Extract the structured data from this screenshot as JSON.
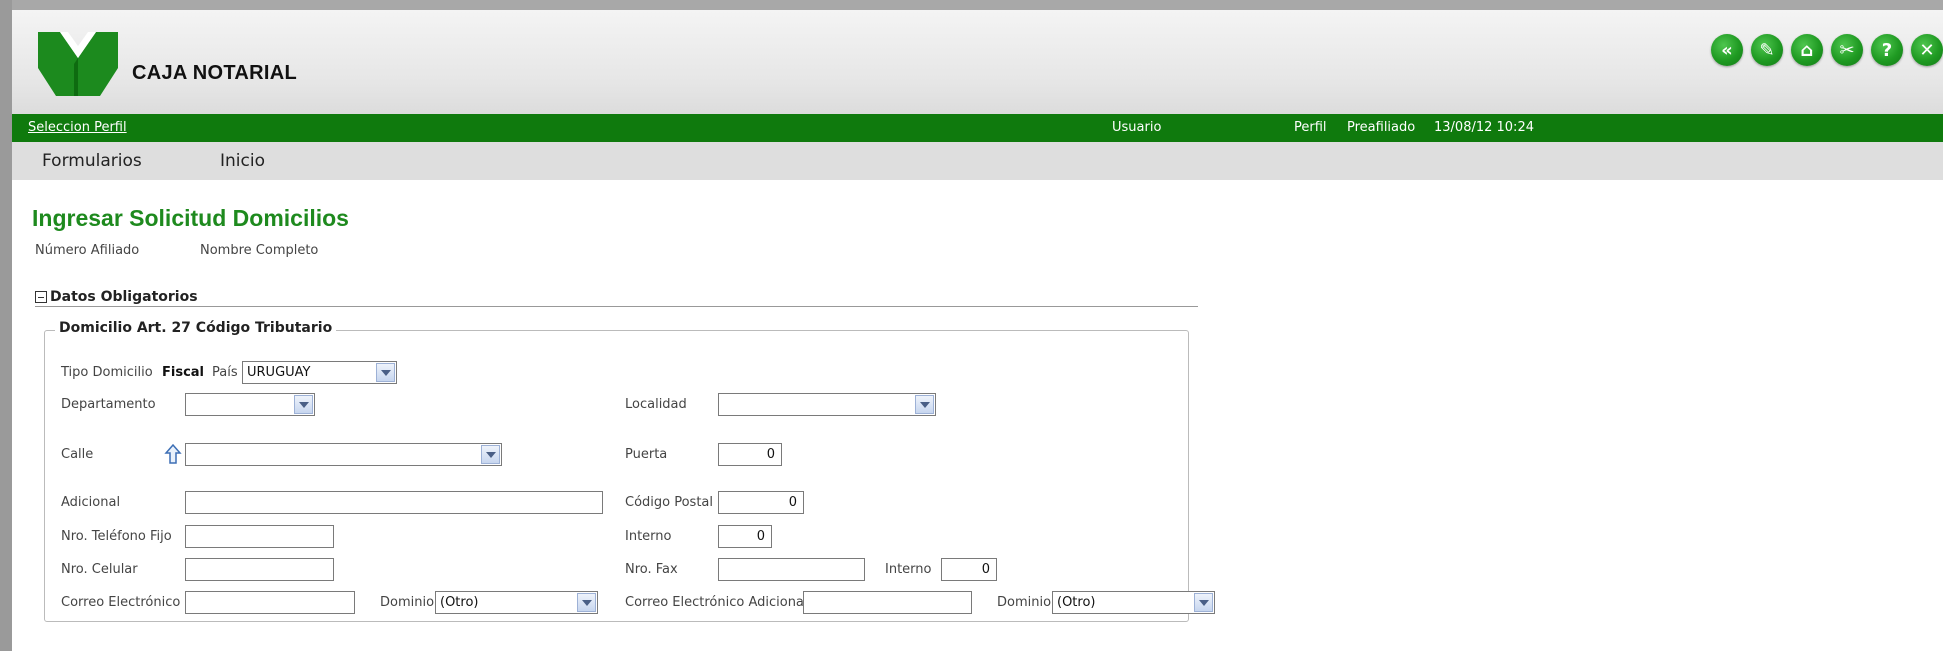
{
  "brand": {
    "name": "CAJA NOTARIAL"
  },
  "header_icons": [
    {
      "name": "back-double-icon",
      "glyph": "«"
    },
    {
      "name": "edit-icon",
      "glyph": "✎"
    },
    {
      "name": "home-icon",
      "glyph": "⌂"
    },
    {
      "name": "tools-icon",
      "glyph": "✂"
    },
    {
      "name": "help-icon",
      "glyph": "?"
    },
    {
      "name": "close-icon",
      "glyph": "✕"
    }
  ],
  "statusbar": {
    "select_profile": "Seleccion Perfil",
    "user_label": "Usuario",
    "profile_label": "Perfil",
    "profile_value": "Preafiliado",
    "datetime": "13/08/12 10:24"
  },
  "menu": {
    "forms": "Formularios",
    "home": "Inicio"
  },
  "page": {
    "title": "Ingresar Solicitud Domicilios",
    "affiliate_number_label": "Número Afiliado",
    "full_name_label": "Nombre Completo"
  },
  "section": {
    "title": "Datos Obligatorios"
  },
  "fieldset": {
    "legend": "Domicilio Art. 27 Código Tributario"
  },
  "form": {
    "tipo_domicilio_label": "Tipo Domicilio",
    "tipo_domicilio_value": "Fiscal",
    "pais_label": "País",
    "pais_value": "URUGUAY",
    "departamento_label": "Departamento",
    "departamento_value": "",
    "localidad_label": "Localidad",
    "localidad_value": "",
    "calle_label": "Calle",
    "calle_value": "",
    "puerta_label": "Puerta",
    "puerta_value": "0",
    "adicional_label": "Adicional",
    "adicional_value": "",
    "codigo_postal_label": "Código Postal",
    "codigo_postal_value": "0",
    "telefono_label": "Nro. Teléfono Fijo",
    "telefono_value": "",
    "interno_label": "Interno",
    "interno_value": "0",
    "celular_label": "Nro. Celular",
    "celular_value": "",
    "fax_label": "Nro. Fax",
    "fax_value": "",
    "fax_interno_label": "Interno",
    "fax_interno_value": "0",
    "correo_label": "Correo Electrónico",
    "correo_value": "",
    "dominio_label": "Dominio",
    "dominio_value": "(Otro)",
    "correo_adicional_label": "Correo Electrónico Adicional",
    "correo_adicional_value": "",
    "dominio2_label": "Dominio",
    "dominio2_value": "(Otro)"
  },
  "colors": {
    "green_bar": "#0f7a0d",
    "title_green": "#1e8a1e",
    "icon_green": "#1f9a22"
  }
}
